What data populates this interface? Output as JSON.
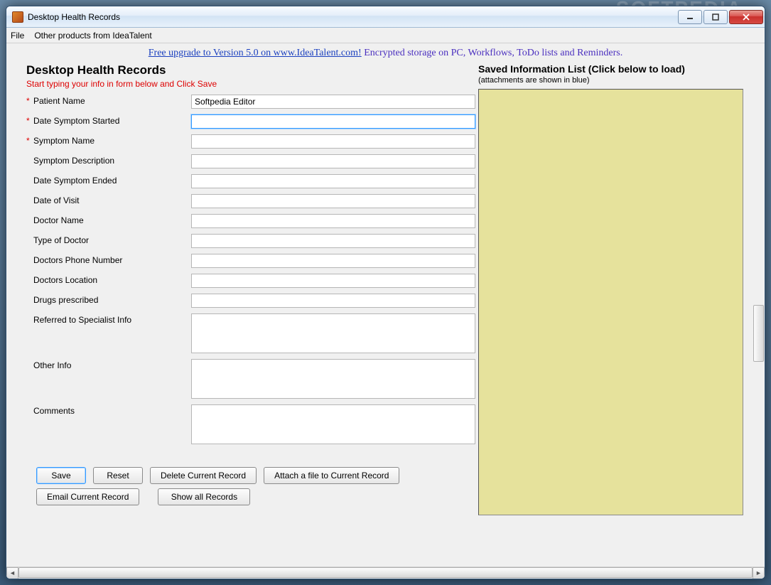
{
  "window": {
    "title": "Desktop Health Records"
  },
  "menubar": {
    "file": "File",
    "other": "Other products from IdeaTalent"
  },
  "banner": {
    "link": "Free upgrade to Version 5.0 on www.IdeaTalent.com!",
    "rest": " Encrypted storage on PC, Workflows, ToDo lists and Reminders."
  },
  "left": {
    "heading": "Desktop Health Records",
    "subheading": "Start typing your info in form below and Click Save",
    "fields": {
      "patient_name": {
        "label": "Patient Name",
        "value": "Softpedia Editor",
        "required": true
      },
      "date_symptom_started": {
        "label": "Date Symptom Started",
        "value": "",
        "required": true
      },
      "symptom_name": {
        "label": "Symptom Name",
        "value": "",
        "required": true
      },
      "symptom_description": {
        "label": "Symptom Description",
        "value": "",
        "required": false
      },
      "date_symptom_ended": {
        "label": "Date  Symptom Ended",
        "value": "",
        "required": false
      },
      "date_of_visit": {
        "label": "Date of Visit",
        "value": "",
        "required": false
      },
      "doctor_name": {
        "label": "Doctor Name",
        "value": "",
        "required": false
      },
      "type_of_doctor": {
        "label": "Type of Doctor",
        "value": "",
        "required": false
      },
      "doctors_phone": {
        "label": "Doctors Phone Number",
        "value": "",
        "required": false
      },
      "doctors_location": {
        "label": "Doctors Location",
        "value": "",
        "required": false
      },
      "drugs_prescribed": {
        "label": "Drugs prescribed",
        "value": "",
        "required": false
      },
      "referred_specialist": {
        "label": "Referred to Specialist Info",
        "value": "",
        "required": false
      },
      "other_info": {
        "label": "Other Info",
        "value": "",
        "required": false
      },
      "comments": {
        "label": "Comments",
        "value": "",
        "required": false
      }
    },
    "buttons": {
      "save": "Save",
      "reset": "Reset",
      "delete": "Delete Current Record",
      "attach": "Attach a file to Current Record",
      "email": "Email Current Record",
      "show_all": "Show all Records"
    }
  },
  "right": {
    "heading": "Saved Information List (Click below to load)",
    "sub": "(attachments are shown in blue)"
  },
  "bg_brand": "SOFTPEDIA"
}
